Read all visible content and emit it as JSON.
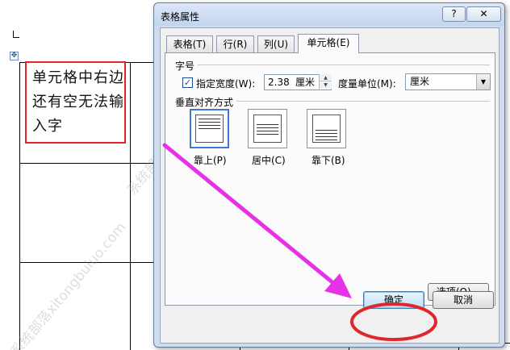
{
  "document": {
    "cell_text": "单元格中右边还有空无法输入字",
    "move_handle_icon": "table-move-handle-icon",
    "watermark_text": "系统部落xitongbuluo.com"
  },
  "dialog": {
    "title": "表格属性",
    "help_label": "?",
    "close_label": "✕",
    "tabs": [
      {
        "label": "表格(T)",
        "active": false
      },
      {
        "label": "行(R)",
        "active": false
      },
      {
        "label": "列(U)",
        "active": false
      },
      {
        "label": "单元格(E)",
        "active": true
      }
    ],
    "size_section": {
      "label": "字号",
      "width_checkbox_checked": true,
      "width_label": "指定宽度(W):",
      "width_value": "2.38",
      "width_unit": "厘米",
      "measure_label": "度量单位(M):",
      "measure_value": "厘米"
    },
    "valign_section": {
      "label": "垂直对齐方式",
      "options": [
        {
          "label": "靠上(P)",
          "selected": true
        },
        {
          "label": "居中(C)",
          "selected": false
        },
        {
          "label": "靠下(B)",
          "selected": false
        }
      ]
    },
    "options_button": "选项(O)...",
    "ok_button": "确定",
    "cancel_button": "取消"
  },
  "annotation": {
    "highlight_color": "#e0262d",
    "arrow_color": "#e632e6"
  }
}
